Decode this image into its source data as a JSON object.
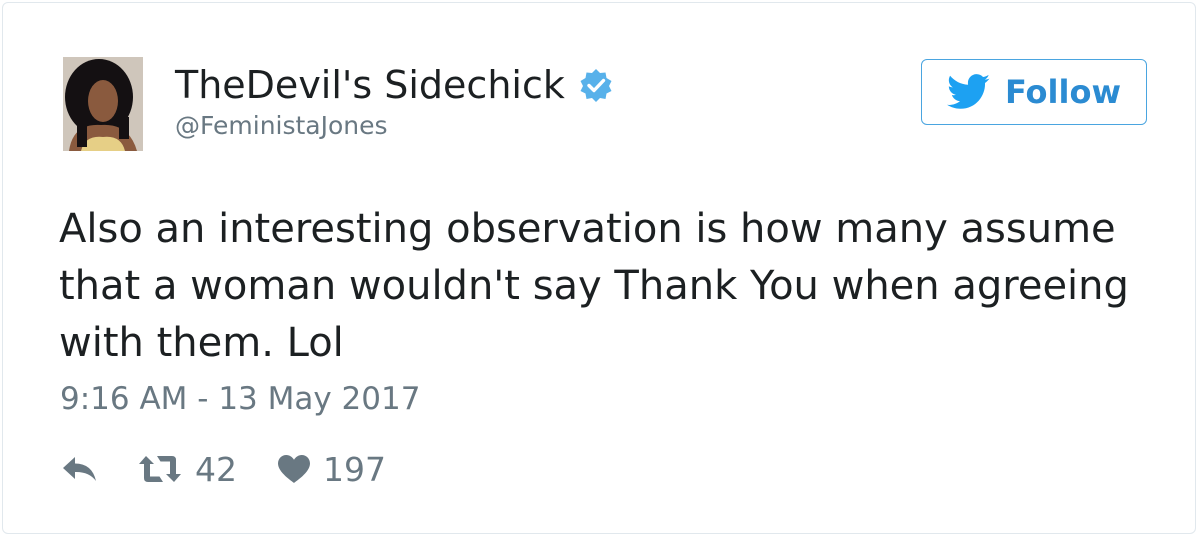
{
  "user": {
    "display_name": "TheDevil's Sidechick",
    "handle": "@FeministaJones",
    "verified": true,
    "avatar_icon": "profile-photo"
  },
  "follow_button": {
    "label": "Follow",
    "icon": "twitter-bird-icon"
  },
  "tweet": {
    "text": "Also an interesting observation is how many assume that a woman wouldn't say Thank You when agreeing with them. Lol",
    "timestamp": "9:16 AM - 13 May 2017"
  },
  "actions": {
    "reply_icon": "reply-icon",
    "retweet_icon": "retweet-icon",
    "retweet_count": "42",
    "like_icon": "heart-icon",
    "like_count": "197"
  },
  "colors": {
    "text_primary": "#1c2022",
    "text_secondary": "#697882",
    "twitter_blue": "#1da1f2",
    "follow_blue": "#2b8bd2",
    "card_border": "#e1e8ed"
  }
}
